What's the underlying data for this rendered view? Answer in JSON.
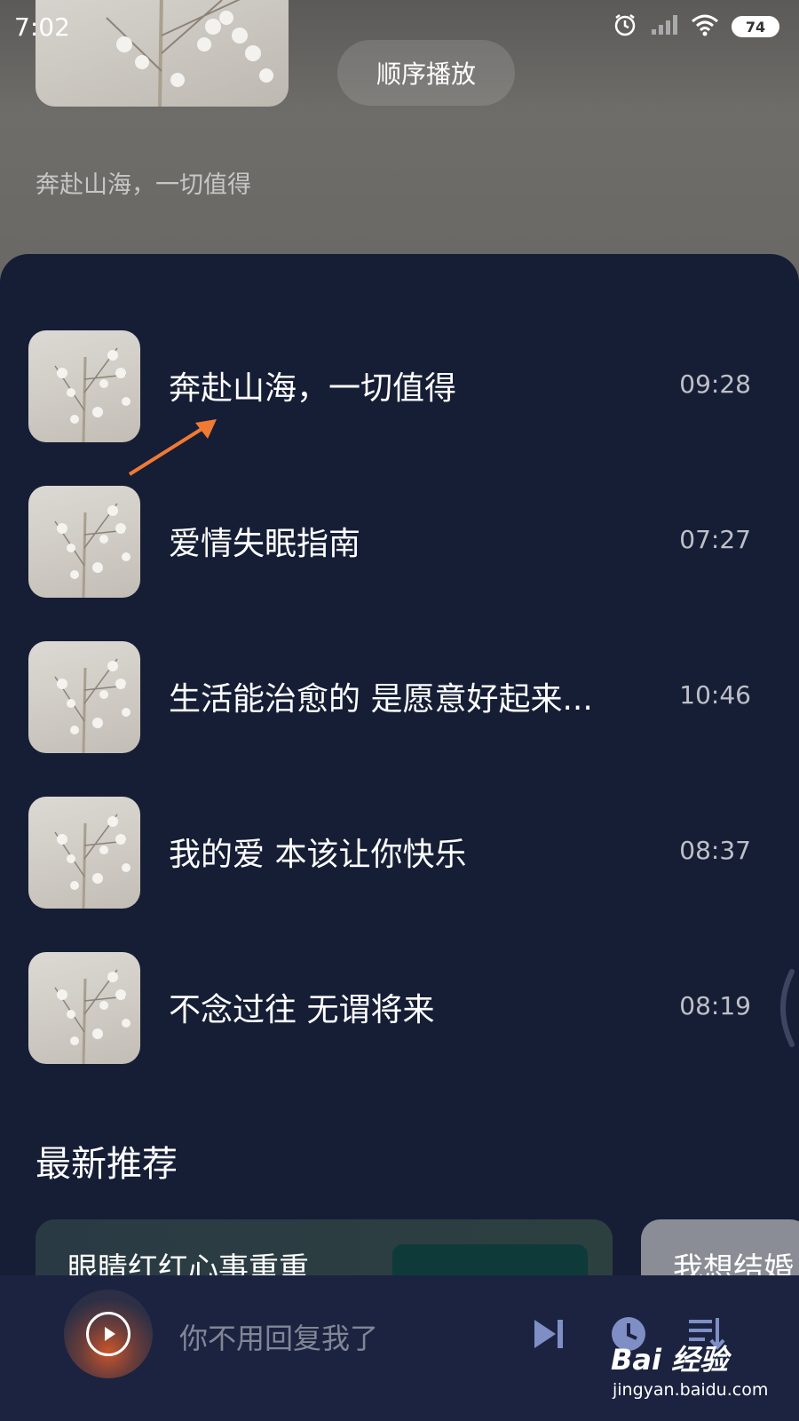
{
  "status_bar": {
    "time": "7:02",
    "battery": "74",
    "icons": [
      "alarm-icon",
      "signal-icon",
      "wifi-icon",
      "battery-icon"
    ]
  },
  "header": {
    "play_mode": "顺序播放",
    "album_subtitle": "奔赴山海，一切值得"
  },
  "tracks": [
    {
      "title": "奔赴山海，一切值得",
      "duration": "09:28"
    },
    {
      "title": "爱情失眠指南",
      "duration": "07:27"
    },
    {
      "title": "生活能治愈的 是愿意好起来...",
      "duration": "10:46"
    },
    {
      "title": "我的爱 本该让你快乐",
      "duration": "08:37"
    },
    {
      "title": "不念过往 无谓将来",
      "duration": "08:19"
    }
  ],
  "recommend": {
    "section_title": "最新推荐",
    "cards": [
      {
        "title": "眼睛红红心事重重"
      },
      {
        "title": "我想结婚"
      }
    ]
  },
  "player": {
    "now_playing": "你不用回复我了",
    "controls": [
      "next-icon",
      "timer-icon",
      "playlist-icon"
    ]
  },
  "watermark": {
    "brand": "Bai 经验",
    "url": "jingyan.baidu.com"
  },
  "colors": {
    "sheet_bg": "#161e36",
    "accent_arrow": "#f07a34",
    "player_icon": "#7f8fc6"
  }
}
